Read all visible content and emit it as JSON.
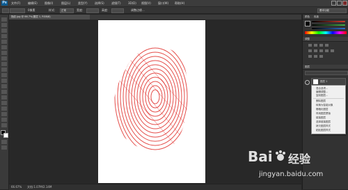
{
  "menubar": {
    "logo": "Ps",
    "items": [
      "文件(F)",
      "编辑(E)",
      "图像(I)",
      "图层(L)",
      "类型(Y)",
      "选择(S)",
      "滤镜(T)",
      "3D(D)",
      "视图(V)",
      "窗口(W)",
      "帮助(H)"
    ]
  },
  "options": {
    "feather_value": "0像素",
    "style_label": "样式:",
    "style_value": "正常",
    "width_label": "宽度:",
    "height_label": "高度:",
    "refine_edge": "调整边缘...",
    "workspace": "基本功能"
  },
  "document": {
    "tab_title": "指纹.jpg @ 66.7%(图层 1, RGB/8)",
    "zoom": "66.67%",
    "doc_size": "文档:1.07M/2.14M"
  },
  "panels": {
    "color_title": "颜色",
    "swatches_title": "色板",
    "adjustments_title": "调整",
    "layers_title": "图层",
    "layer_name": "图层 1",
    "colors": {
      "swatch_red": "#d43b2f",
      "swatch_green": "#43b449",
      "swatch_blue": "#2c6fd1",
      "fingerprint": "#e23a36"
    }
  },
  "context_menu": {
    "items": [
      "混合选项...",
      "编辑调整...",
      "复制图层...",
      "删除图层",
      "转换为智能对象",
      "栅格化图层",
      "停用图层蒙版",
      "链接图层",
      "选择链接图层",
      "拷贝图层样式",
      "粘贴图层样式",
      "清除图层样式"
    ]
  },
  "watermark": {
    "brand": "Bai",
    "brand_suffix": "经验",
    "url": "jingyan.baidu.com"
  }
}
